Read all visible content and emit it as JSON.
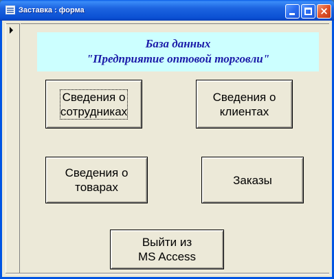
{
  "window": {
    "title": "Заставка : форма",
    "controls": {
      "minimize": "minimize",
      "maximize": "maximize",
      "close": "×"
    }
  },
  "header": {
    "line1": "База данных",
    "line2": "\"Предприятие оптовой торговли\"",
    "text_color": "#1a1aa8",
    "background": "#ccffff"
  },
  "buttons": {
    "employees": "Сведения о\nсотрудниках",
    "clients": "Сведения о\nклиентах",
    "goods": "Сведения о\nтоварах",
    "orders": "Заказы",
    "exit": "Выйти из\nMS Access"
  },
  "icons": {
    "form": "form-icon",
    "record_selector": "record-pointer-icon"
  }
}
